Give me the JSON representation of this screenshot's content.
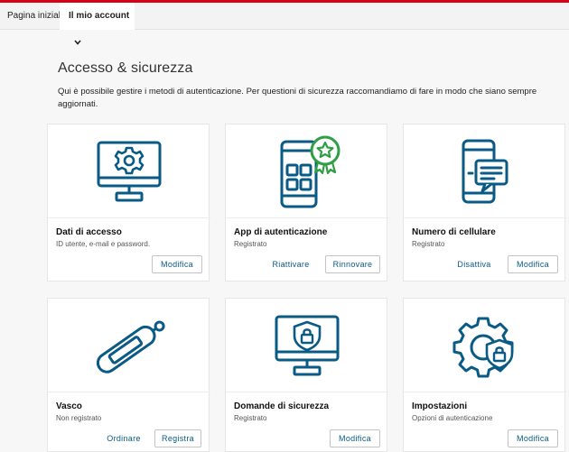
{
  "nav": {
    "home": "Pagina iniziale",
    "account": "Il mio account"
  },
  "page": {
    "title": "Accesso & sicurezza",
    "description": "Qui è possibile gestire i metodi di autenticazione. Per questioni di sicurezza raccomandiamo di fare in modo che siano sempre aggiornati."
  },
  "colors": {
    "accent": "#d7001b",
    "icon": "#0a5a86",
    "badge": "#2f9e44"
  },
  "cards": [
    {
      "title": "Dati di accesso",
      "subtitle": "ID utente, e-mail e password.",
      "icon": "monitor-gear-icon",
      "buttons": [
        "Modifica"
      ]
    },
    {
      "title": "App di autenticazione",
      "subtitle": "Registrato",
      "icon": "phone-app-star-icon",
      "buttons": [
        "Riattivare",
        "Rinnovare"
      ]
    },
    {
      "title": "Numero di cellulare",
      "subtitle": "Registrato",
      "icon": "phone-message-icon",
      "buttons": [
        "Disattiva",
        "Modifica"
      ]
    },
    {
      "title": "Vasco",
      "subtitle": "Non registrato",
      "icon": "usb-token-icon",
      "buttons": [
        "Ordinare",
        "Registra"
      ]
    },
    {
      "title": "Domande di sicurezza",
      "subtitle": "Registrato",
      "icon": "monitor-shield-lock-icon",
      "buttons": [
        "Modifica"
      ]
    },
    {
      "title": "Impostazioni",
      "subtitle": "Opzioni di autenticazione",
      "icon": "gear-shield-lock-icon",
      "buttons": [
        "Modifica"
      ]
    }
  ]
}
